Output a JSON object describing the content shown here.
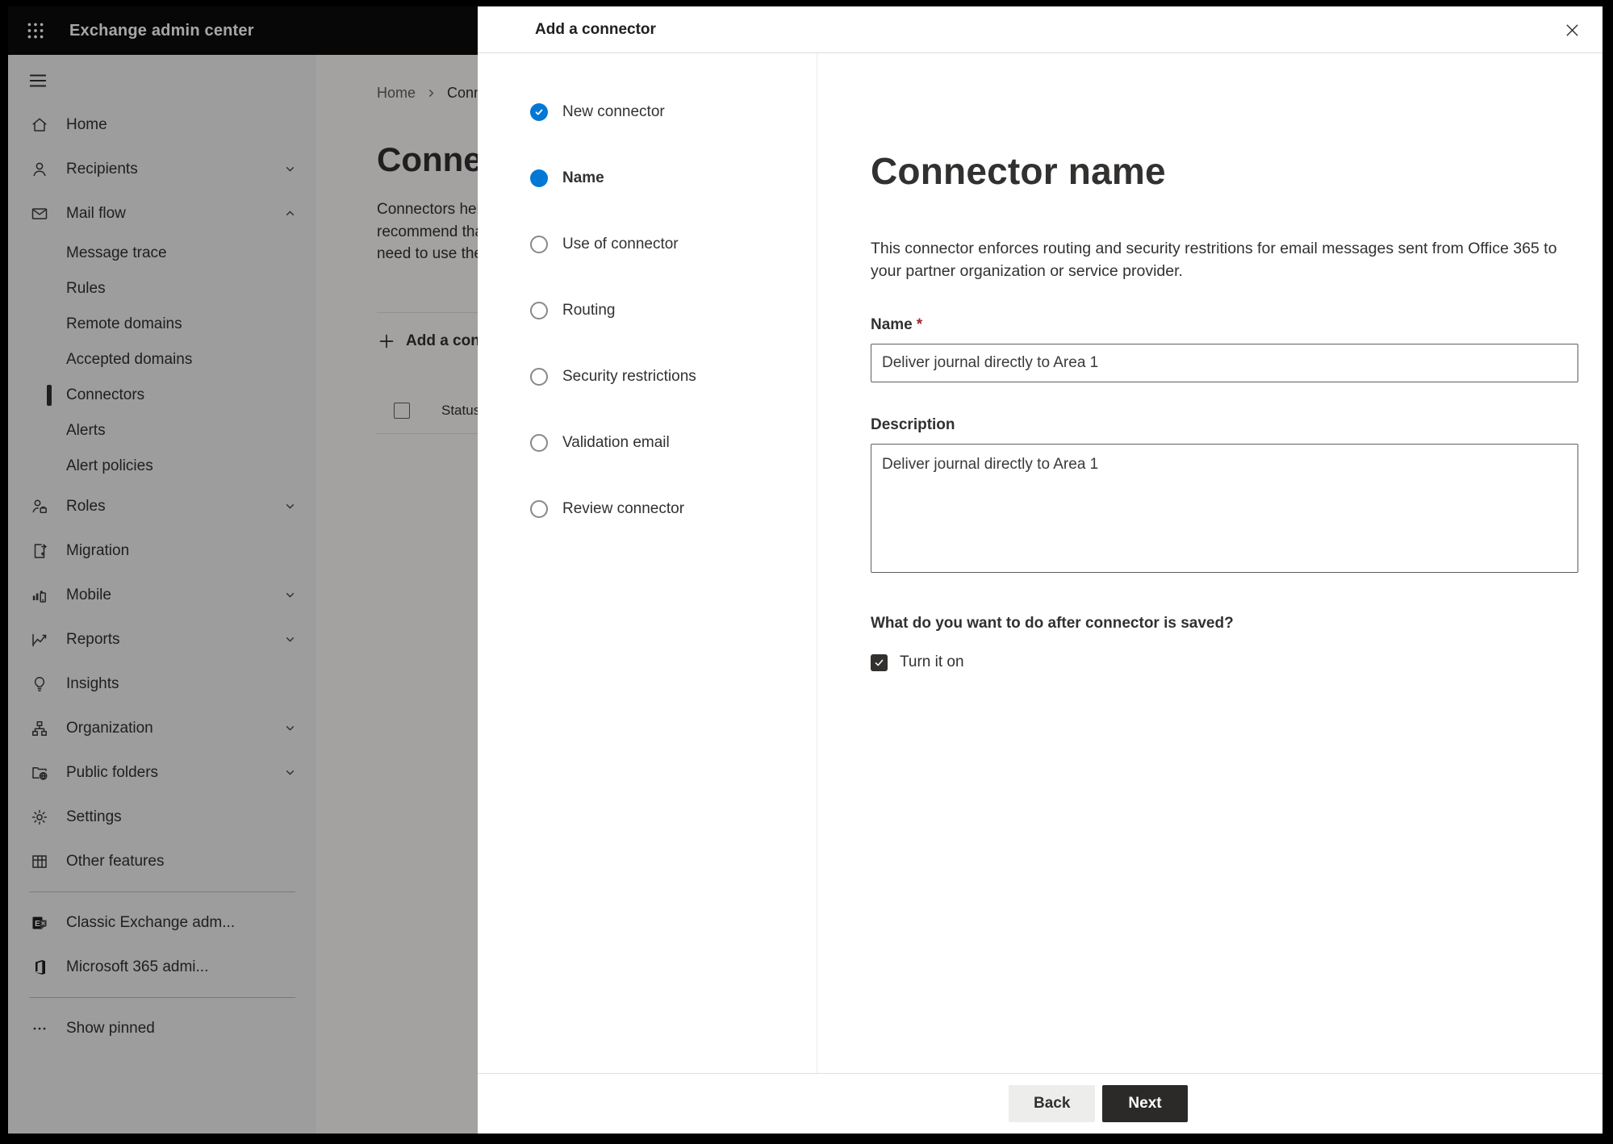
{
  "colors": {
    "accent_blue": "#0078d4",
    "topbar_bg": "#0b0b0b",
    "selected_indicator": "#323130",
    "required_asterisk": "#a4262c",
    "next_button_bg": "#2b2a29",
    "back_button_bg": "#ededeb",
    "sidebar_bg": "#f3f2f1"
  },
  "topbar": {
    "app_title": "Exchange admin center"
  },
  "sidebar": {
    "items": [
      {
        "label": "Home"
      },
      {
        "label": "Recipients"
      },
      {
        "label": "Mail flow"
      },
      {
        "label": "Message trace"
      },
      {
        "label": "Rules"
      },
      {
        "label": "Remote domains"
      },
      {
        "label": "Accepted domains"
      },
      {
        "label": "Connectors",
        "selected": true
      },
      {
        "label": "Alerts"
      },
      {
        "label": "Alert policies"
      },
      {
        "label": "Roles"
      },
      {
        "label": "Migration"
      },
      {
        "label": "Mobile"
      },
      {
        "label": "Reports"
      },
      {
        "label": "Insights"
      },
      {
        "label": "Organization"
      },
      {
        "label": "Public folders"
      },
      {
        "label": "Settings"
      },
      {
        "label": "Other features"
      },
      {
        "label": "Classic Exchange adm..."
      },
      {
        "label": "Microsoft 365 admi..."
      },
      {
        "label": "Show pinned"
      }
    ]
  },
  "page": {
    "breadcrumb": {
      "home": "Home",
      "current": "Conne"
    },
    "title": "Connect",
    "intro_lines": [
      "Connectors help",
      "recommend that",
      "need to use ther"
    ],
    "add_connector_button": "Add a conn",
    "table": {
      "status_header": "Status"
    }
  },
  "modal": {
    "title": "Add a connector",
    "steps": [
      {
        "label": "New connector",
        "state": "completed"
      },
      {
        "label": "Name",
        "state": "current"
      },
      {
        "label": "Use of connector",
        "state": "upcoming"
      },
      {
        "label": "Routing",
        "state": "upcoming"
      },
      {
        "label": "Security restrictions",
        "state": "upcoming"
      },
      {
        "label": "Validation email",
        "state": "upcoming"
      },
      {
        "label": "Review connector",
        "state": "upcoming"
      }
    ],
    "content": {
      "heading": "Connector name",
      "description": "This connector enforces routing and security restritions for email messages sent from Office 365 to your partner organization or service provider.",
      "name_label": "Name",
      "required_marker": "*",
      "name_value": "Deliver journal directly to Area 1",
      "description_label": "Description",
      "description_value": "Deliver journal directly to Area 1",
      "after_save_question": "What do you want to do after connector is saved?",
      "turn_on_label": "Turn it on",
      "turn_on_checked": true
    },
    "footer": {
      "back_label": "Back",
      "next_label": "Next"
    }
  }
}
